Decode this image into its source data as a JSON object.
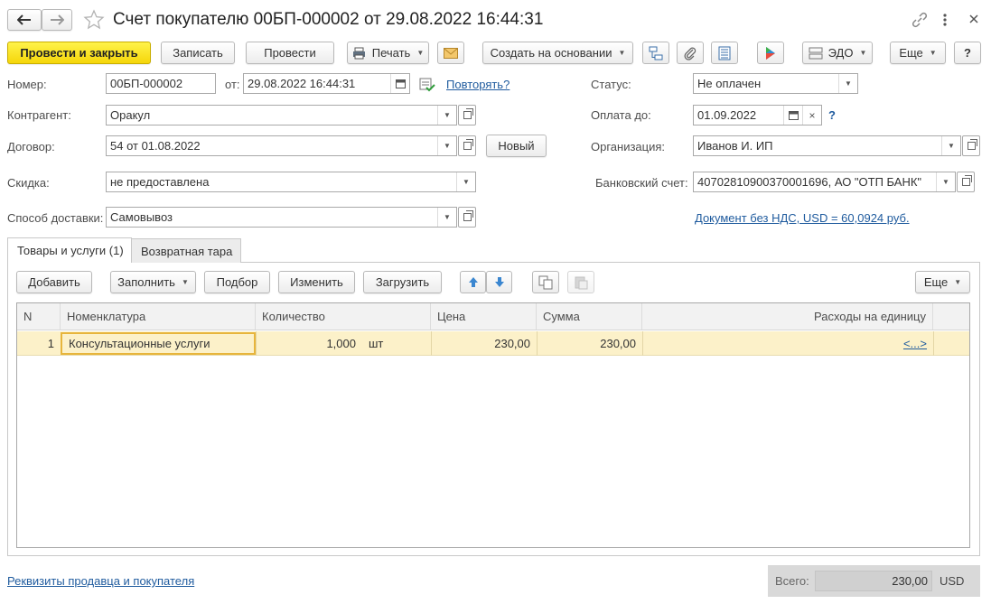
{
  "window": {
    "title": "Счет покупателю 00БП-000002 от 29.08.2022 16:44:31"
  },
  "toolbar": {
    "post_close": "Провести и закрыть",
    "save": "Записать",
    "post": "Провести",
    "print": "Печать",
    "create_based": "Создать на основании",
    "edo": "ЭДО",
    "more": "Еще",
    "help": "?"
  },
  "form": {
    "number_label": "Номер:",
    "number_value": "00БП-000002",
    "date_label": "от:",
    "date_value": "29.08.2022 16:44:31",
    "repeat_link": "Повторять?",
    "status_label": "Статус:",
    "status_value": "Не оплачен",
    "counterparty_label": "Контрагент:",
    "counterparty_value": "Оракул",
    "pay_until_label": "Оплата до:",
    "pay_until_value": "01.09.2022",
    "pay_until_help": "?",
    "contract_label": "Договор:",
    "contract_value": "54 от 01.08.2022",
    "new_button": "Новый",
    "org_label": "Организация:",
    "org_value": "Иванов И. ИП",
    "discount_label": "Скидка:",
    "discount_value": "не предоставлена",
    "bank_label": "Банковский счет:",
    "bank_value": "40702810900370001696, АО \"ОТП БАНК\"",
    "delivery_label": "Способ доставки:",
    "delivery_value": "Самовывоз",
    "vat_link": "Документ без НДС, USD = 60,0924 руб."
  },
  "tabs": [
    {
      "label": "Товары и услуги (1)"
    },
    {
      "label": "Возвратная тара"
    }
  ],
  "table_toolbar": {
    "add": "Добавить",
    "fill": "Заполнить",
    "pick": "Подбор",
    "edit": "Изменить",
    "load": "Загрузить",
    "more": "Еще"
  },
  "table": {
    "headers": {
      "n": "N",
      "item": "Номенклатура",
      "qty": "Количество",
      "price": "Цена",
      "sum": "Сумма",
      "cost": "Расходы на единицу"
    },
    "rows": [
      {
        "n": "1",
        "item": "Консультационные услуги",
        "qty": "1,000",
        "unit": "шт",
        "price": "230,00",
        "sum": "230,00",
        "cost": "<...>"
      }
    ]
  },
  "footer": {
    "requisites_link": "Реквизиты продавца и покупателя",
    "total_label": "Всего:",
    "total_value": "230,00",
    "currency": "USD"
  },
  "colors": {
    "primary_button": "#f5d60a",
    "link": "#1f5b9e",
    "selected_row": "#fcf1c9",
    "selected_cell_border": "#e7b53c"
  }
}
